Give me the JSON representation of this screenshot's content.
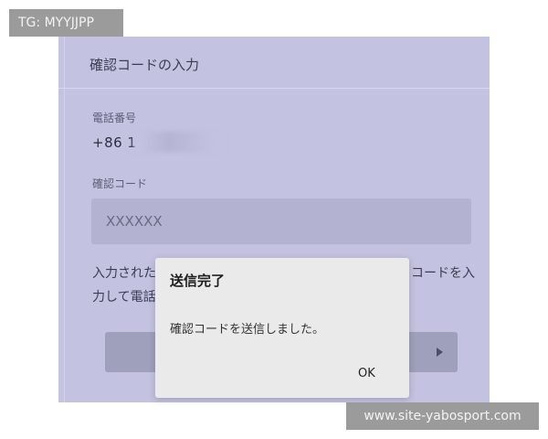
{
  "watermark": {
    "top": "TG: MYYJJPP",
    "bottom": "www.site-yabosport.com"
  },
  "form": {
    "header_title": "確認コードの入力",
    "phone_label": "電話番号",
    "phone_value": "+86 1",
    "code_label": "確認コード",
    "code_placeholder": "XXXXXX",
    "hint_line1": "入力された",
    "hint_line1_right": "コードを入",
    "hint_line2": "力して電話"
  },
  "dialog": {
    "title": "送信完了",
    "message": "確認コードを送信しました。",
    "ok_label": "OK"
  },
  "colors": {
    "screen_tint": "#c3c2e0",
    "dialog_bg": "#eaeaea",
    "watermark_bg": "#9b9b9b"
  }
}
